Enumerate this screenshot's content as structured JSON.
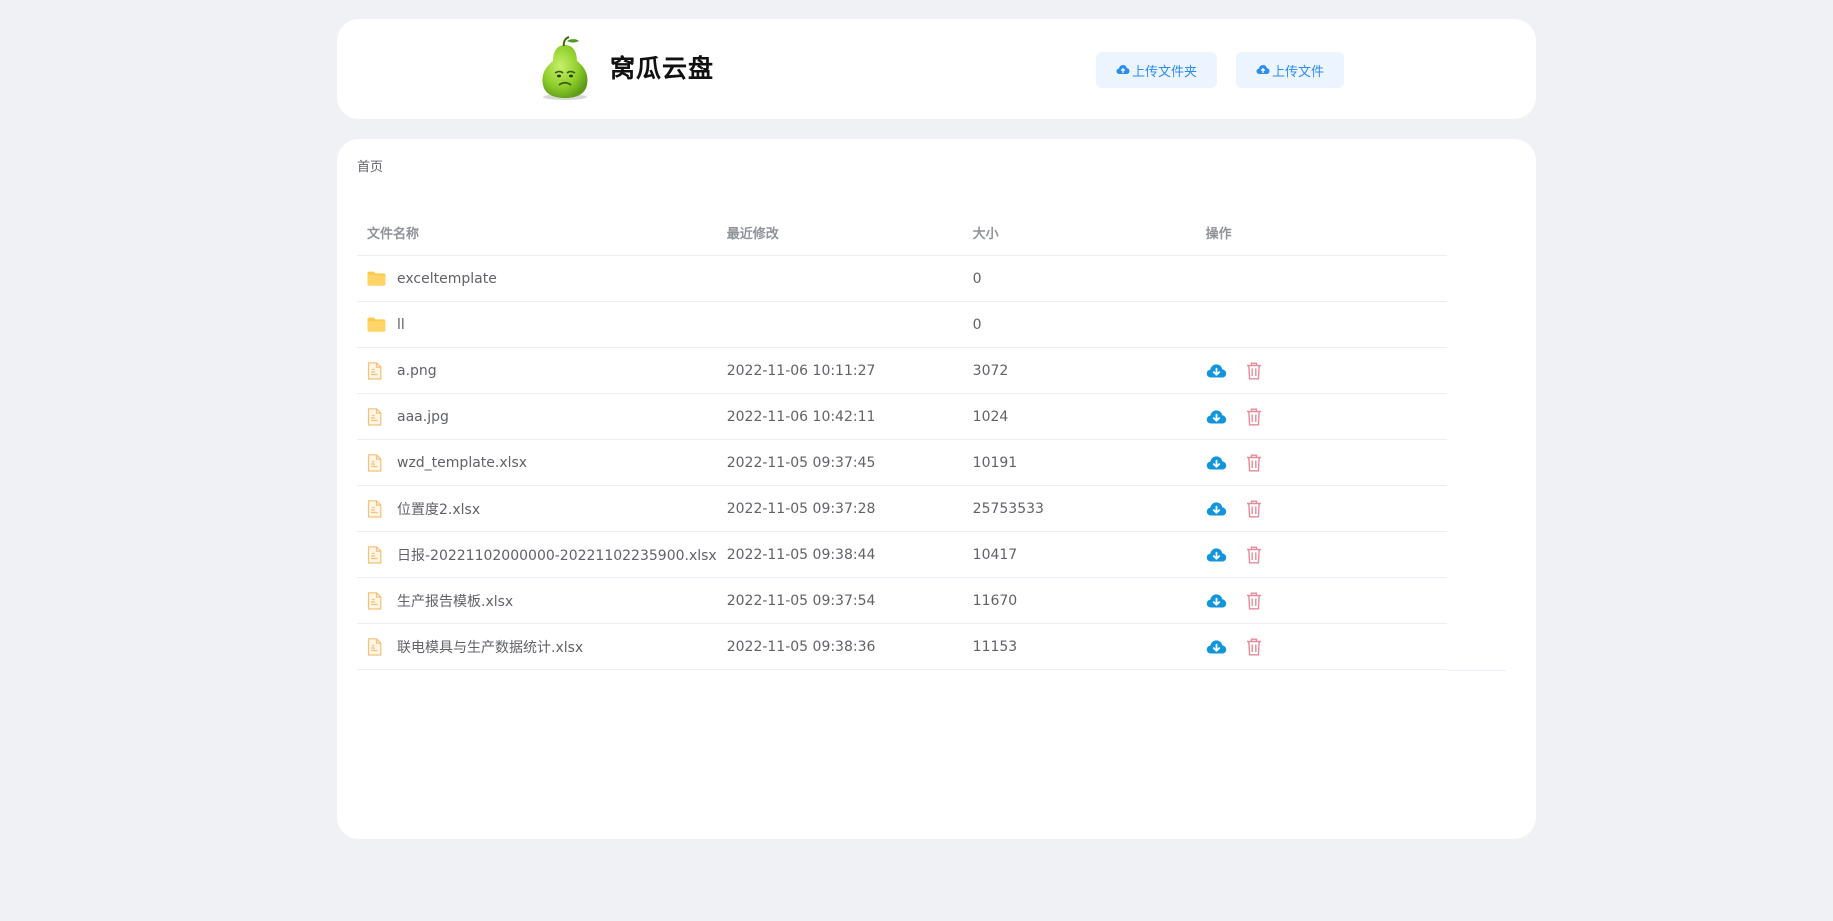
{
  "app": {
    "title": "窝瓜云盘",
    "logo_icon": "pear-mascot-icon",
    "accent_color": "#2d8cf0",
    "delete_color": "#e88a9b",
    "folder_color": "#ffc94d"
  },
  "toolbar": {
    "upload_folder_label": "上传文件夹",
    "upload_file_label": "上传文件",
    "upload_icon": "cloud-upload-icon"
  },
  "breadcrumb": {
    "home": "首页"
  },
  "table": {
    "headers": {
      "name": "文件名称",
      "modified": "最近修改",
      "size": "大小",
      "ops": "操作"
    },
    "rows": [
      {
        "type": "folder",
        "name": "exceltemplate",
        "modified": "",
        "size": "0"
      },
      {
        "type": "folder",
        "name": "ll",
        "modified": "",
        "size": "0"
      },
      {
        "type": "file",
        "name": "a.png",
        "modified": "2022-11-06 10:11:27",
        "size": "3072"
      },
      {
        "type": "file",
        "name": "aaa.jpg",
        "modified": "2022-11-06 10:42:11",
        "size": "1024"
      },
      {
        "type": "file",
        "name": "wzd_template.xlsx",
        "modified": "2022-11-05 09:37:45",
        "size": "10191"
      },
      {
        "type": "file",
        "name": "位置度2.xlsx",
        "modified": "2022-11-05 09:37:28",
        "size": "25753533"
      },
      {
        "type": "file",
        "name": "日报-20221102000000-20221102235900.xlsx",
        "modified": "2022-11-05 09:38:44",
        "size": "10417"
      },
      {
        "type": "file",
        "name": "生产报告模板.xlsx",
        "modified": "2022-11-05 09:37:54",
        "size": "11670"
      },
      {
        "type": "file",
        "name": "联电模具与生产数据统计.xlsx",
        "modified": "2022-11-05 09:38:36",
        "size": "11153"
      }
    ]
  }
}
